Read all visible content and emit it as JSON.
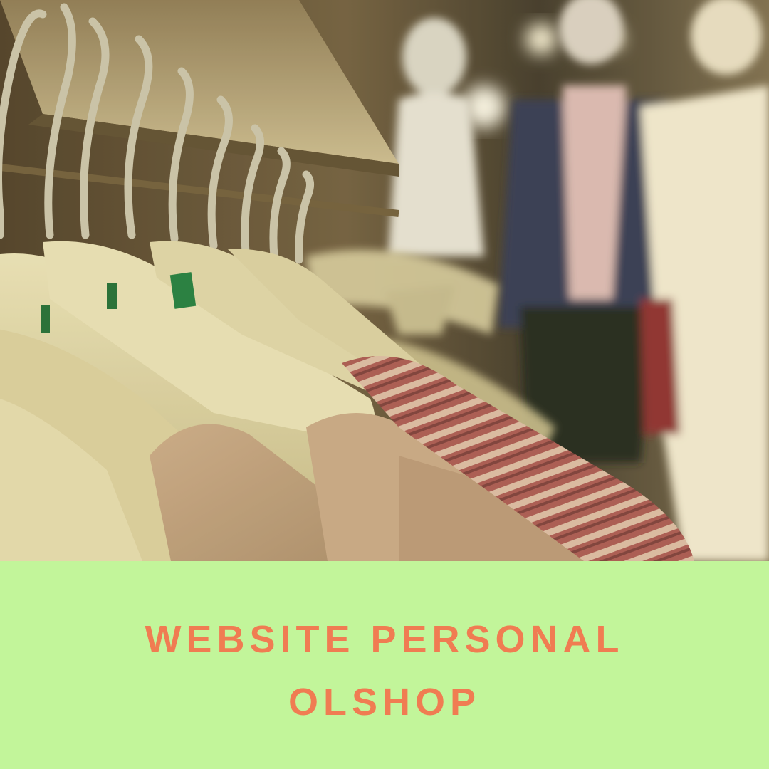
{
  "caption": {
    "line1": "WEBSITE PERSONAL",
    "line2": "OLSHOP"
  },
  "photo": {
    "subject": "clothes-rack-with-hangers-and-mannequins"
  },
  "colors": {
    "caption_background": "#c2f59a",
    "caption_text": "#f07c52"
  }
}
